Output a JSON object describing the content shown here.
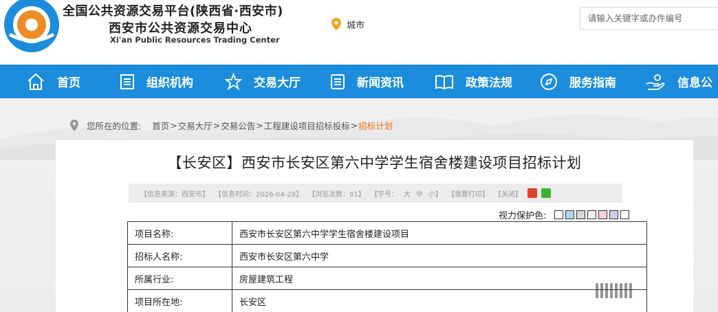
{
  "header": {
    "title_main": "全国公共资源交易平台(陕西省·西安市)",
    "title_sub": "西安市公共资源交易中心",
    "title_en": "Xi'an Public Resources Trading Center",
    "city_label": "城市",
    "search_placeholder": "请输入关键字或办件编号",
    "logo_colors": {
      "outer": "#1c8ddc",
      "inner": "#f08a24"
    }
  },
  "nav": {
    "items": [
      {
        "label": "首页",
        "icon": "home-icon"
      },
      {
        "label": "组织机构",
        "icon": "document-icon"
      },
      {
        "label": "交易大厅",
        "icon": "star-icon"
      },
      {
        "label": "新闻资讯",
        "icon": "list-icon"
      },
      {
        "label": "政策法规",
        "icon": "book-icon"
      },
      {
        "label": "服务指南",
        "icon": "compass-icon"
      },
      {
        "label": "信息公",
        "icon": "hand-icon"
      }
    ],
    "background": "#1c8ddc"
  },
  "breadcrumb": {
    "label": "您所在的位置:",
    "items": [
      "首页",
      "交易大厅",
      "交易公告",
      "工程建设项目招标投标",
      "招标计划"
    ],
    "separator": ">"
  },
  "article": {
    "title": "【长安区】西安市长安区第六中学学生宿舍楼建设项目招标计划",
    "meta": {
      "source": "【信息来源：西安市】",
      "time": "【信息时间：2026-04-28】",
      "views": "【浏览次数：91】",
      "font_label": "【字号：",
      "font_large": "大",
      "font_medium": "中",
      "font_small": "小】",
      "print": "【我要打印】",
      "close": "【关闭】"
    },
    "eye_protection_label": "视力保护色:",
    "eye_protection_colors": [
      "#ffffff",
      "#a8d8f0",
      "#d8d8d8",
      "#f0f0f0",
      "#f8d0e0",
      "#d8c8f0",
      "#ffffff"
    ]
  },
  "table": {
    "rows": [
      {
        "key": "项目名称:",
        "value": "西安市长安区第六中学学生宿舍楼建设项目"
      },
      {
        "key": "招标人名称:",
        "value": "西安市长安区第六中学"
      },
      {
        "key": "所属行业:",
        "value": "房屋建筑工程"
      },
      {
        "key": "项目所在地:",
        "value": "长安区"
      }
    ]
  }
}
